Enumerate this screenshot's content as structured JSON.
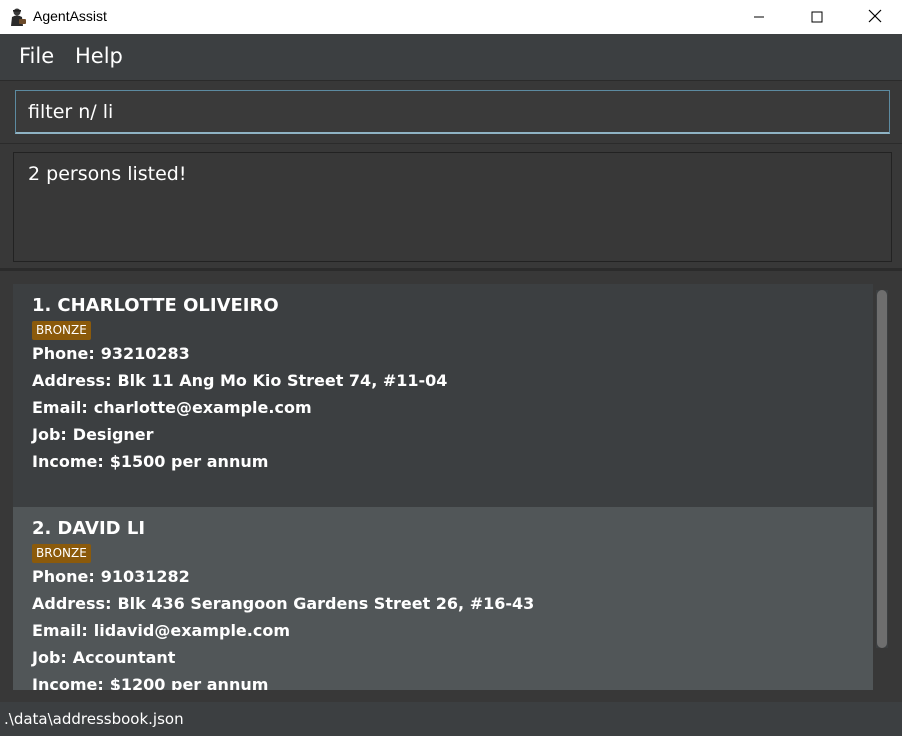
{
  "window": {
    "title": "AgentAssist"
  },
  "menu": {
    "file_label": "File",
    "help_label": "Help"
  },
  "command": {
    "value": "filter n/ li"
  },
  "result": {
    "message": "2 persons listed!"
  },
  "persons": [
    {
      "index": "1.",
      "name": "CHARLOTTE OLIVEIRO",
      "tag": "BRONZE",
      "phone_label": "Phone:",
      "phone": "93210283",
      "address_label": "Address:",
      "address": "Blk 11 Ang Mo Kio Street 74, #11-04",
      "email_label": "Email:",
      "email": "charlotte@example.com",
      "job_label": "Job:",
      "job": "Designer",
      "income_label": "Income:",
      "income": "$1500 per annum"
    },
    {
      "index": "2.",
      "name": "DAVID LI",
      "tag": "BRONZE",
      "phone_label": "Phone:",
      "phone": "91031282",
      "address_label": "Address:",
      "address": "Blk 436 Serangoon Gardens Street 26, #16-43",
      "email_label": "Email:",
      "email": "lidavid@example.com",
      "job_label": "Job:",
      "job": "Accountant",
      "income_label": "Income:",
      "income": "$1200 per annum"
    }
  ],
  "status": {
    "file_path": ".\\data\\addressbook.json"
  },
  "colors": {
    "background": "#2b2b2b",
    "card_odd": "#3c3f41",
    "card_even": "#515658",
    "tag_bronze": "#8b5a0b"
  }
}
